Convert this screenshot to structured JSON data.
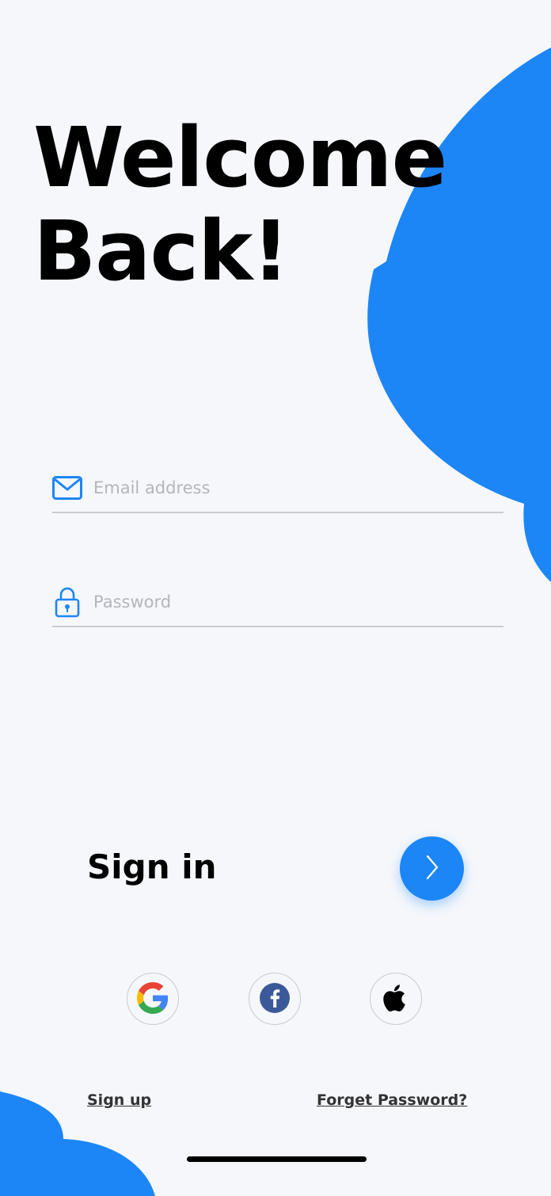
{
  "header": {
    "title_line1": "Welcome",
    "title_line2": "Back!"
  },
  "form": {
    "email": {
      "placeholder": "Email address",
      "value": ""
    },
    "password": {
      "placeholder": "Password",
      "value": ""
    }
  },
  "signin": {
    "label": "Sign in"
  },
  "social": [
    "google-icon",
    "facebook-icon",
    "apple-icon"
  ],
  "footer": {
    "signup_label": "Sign up",
    "forget_label": "Forget Password?"
  },
  "colors": {
    "accent": "#1c86f7",
    "background": "#f5f7fb",
    "facebook": "#3b5998"
  }
}
